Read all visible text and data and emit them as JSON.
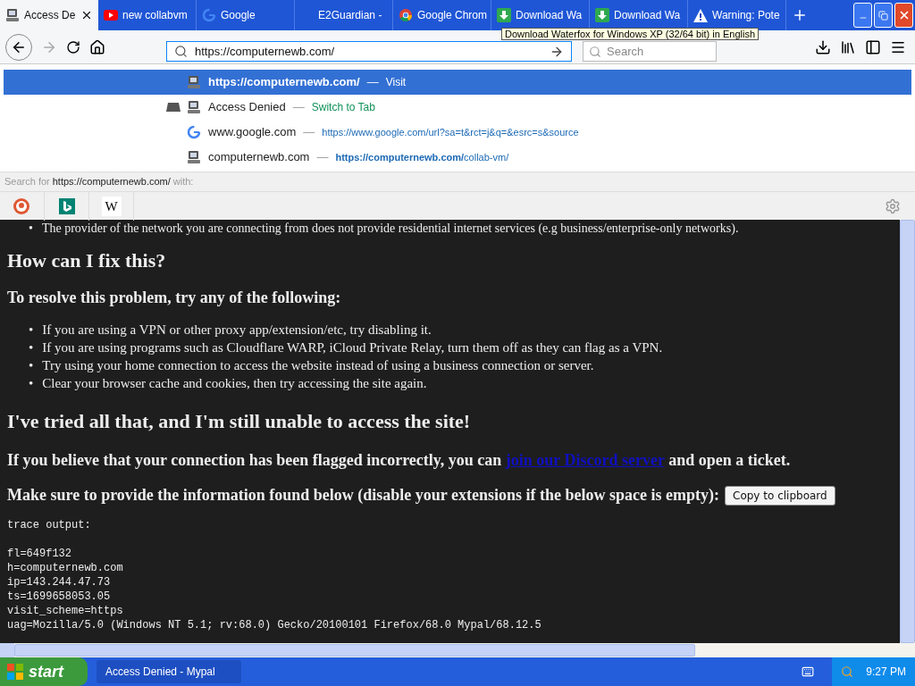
{
  "tabs": [
    {
      "title": "Access De",
      "selected": true,
      "kind": "computer"
    },
    {
      "title": "new collabvm",
      "selected": false,
      "kind": "video"
    },
    {
      "title": "Google",
      "selected": false,
      "kind": "google"
    },
    {
      "title": "E2Guardian -",
      "selected": false,
      "kind": "plain"
    },
    {
      "title": "Google Chrom",
      "selected": false,
      "kind": "chrome"
    },
    {
      "title": "Download Wa",
      "selected": false,
      "kind": "download"
    },
    {
      "title": "Download Wa",
      "selected": false,
      "kind": "download"
    },
    {
      "title": "Warning: Pote",
      "selected": false,
      "kind": "warning"
    }
  ],
  "tooltip": "Download Waterfox for Windows XP (32/64 bit) in English",
  "address": {
    "value": "https://computernewb.com/"
  },
  "search": {
    "placeholder": "Search"
  },
  "suggestions": [
    {
      "kind": "visit",
      "selected": true,
      "title": "https://computernewb.com/",
      "separator": "—",
      "detail": "Visit"
    },
    {
      "kind": "switch_tab",
      "selected": false,
      "title": "Access Denied",
      "separator": "—",
      "detail": "Switch to Tab"
    },
    {
      "kind": "search_url",
      "selected": false,
      "title": "www.google.com",
      "separator": "—",
      "detail": "https://www.google.com/url?sa=t&rct=j&q=&esrc=s&source"
    },
    {
      "kind": "url",
      "selected": false,
      "title": "computernewb.com",
      "separator": "—",
      "detail": "**https://computernewb.com/**collab-vm/"
    }
  ],
  "search_for": {
    "prefix": "Search for",
    "query": "https://computernewb.com/",
    "suffix": "with:"
  },
  "engines": [
    {
      "kind": "duckduckgo"
    },
    {
      "kind": "bing"
    },
    {
      "kind": "wikipedia",
      "label": "W"
    }
  ],
  "page": {
    "bullet": "•",
    "cut_bullet": "The provider of the network you are connecting from does not provide residential internet services (e.g business/enterprise-only networks).",
    "heading_fix": "How can I fix this?",
    "subheading": "To resolve this problem, try any of the following:",
    "steps": [
      "If you are using a VPN or other proxy app/extension/etc, try disabling it.",
      "If you are using programs such as Cloudflare WARP, iCloud Private Relay, turn them off as they can flag as a VPN.",
      "Try using your home connection to access the website instead of using a business connection or server.",
      "Clear your browser cache and cookies, then try accessing the site again."
    ],
    "heading_tried": "I've tried all that, and I'm still unable to access the site!",
    "flagged": {
      "before": "If you believe that your connection has been flagged incorrectly, you can",
      "link": "join our Discord server",
      "after": "and open a ticket."
    },
    "provide": "Make sure to provide the information found below (disable your extensions if the below space is empty):",
    "copy_button": "Copy to clipboard",
    "trace": [
      "trace output:",
      "fl=649f132",
      "h=computernewb.com",
      "ip=143.244.47.73",
      "ts=1699658053.05",
      "visit_scheme=https",
      "uag=Mozilla/5.0 (Windows NT 5.1; rv:68.0) Gecko/20100101 Firefox/68.0 Mypal/68.12.5"
    ]
  },
  "taskbar": {
    "start": "start",
    "task": "Access Denied - Mypal",
    "clock": "9:27 PM"
  }
}
